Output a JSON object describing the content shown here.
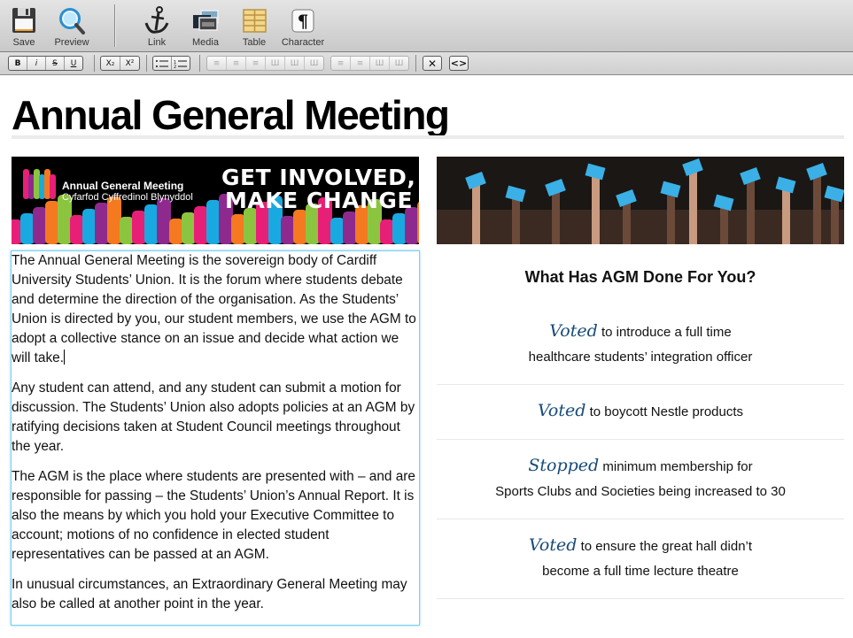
{
  "toolbar": {
    "buttons": [
      {
        "label": "Save",
        "icon": "floppy-disk-icon"
      },
      {
        "label": "Preview",
        "icon": "magnifier-icon"
      },
      {
        "label": "Link",
        "icon": "anchor-icon"
      },
      {
        "label": "Media",
        "icon": "media-icon"
      },
      {
        "label": "Table",
        "icon": "table-icon"
      },
      {
        "label": "Character",
        "icon": "pilcrow-icon"
      }
    ]
  },
  "format_toolbar": {
    "text_style": [
      "B",
      "i",
      "S",
      "U"
    ],
    "script": [
      "X₂",
      "X²"
    ],
    "lists": [
      "bulleted-list",
      "numbered-list"
    ],
    "table_row_col": [
      "insert-row-before",
      "insert-row-after",
      "delete-row",
      "insert-col-before",
      "insert-col-after",
      "delete-col"
    ],
    "table_cells": [
      "split-cell",
      "merge-cell",
      "split-col",
      "merge-col"
    ],
    "remove_format": "✕",
    "source_code": "<>"
  },
  "page": {
    "title": "Annual General Meeting",
    "banner_left": {
      "title": "Annual General Meeting",
      "subtitle": "Cyfarfod Cyffredinol Blynyddol",
      "headline_1": "GET INVOLVED,",
      "headline_2": "MAKE CHANGE"
    },
    "paragraphs": [
      "The Annual General Meeting is the sovereign body of Cardiff University Students’ Union. It is the forum where students debate and determine the direction of the organisation. As the Students’ Union is directed by you, our student members, we use the AGM to adopt a collective stance on an issue and decide what action we will take.",
      "Any student can attend, and any student can submit a motion for discussion. The Students’ Union also adopts policies at an AGM by ratifying decisions taken at Student Council meetings throughout the year.",
      "The AGM is the place where students are presented with – and are responsible for passing – the Students’ Union’s Annual Report. It is also the means by which you hold your Executive Committee to account; motions of no confidence in elected student representatives can be passed at an AGM.",
      "In unusual circumstances, an Extraordinary General Meeting may also be called at another point in the year."
    ],
    "sidebar": {
      "heading": "What Has AGM Done For You?",
      "items": [
        {
          "verb": "Voted",
          "line1": "to introduce a full time",
          "line2": "healthcare students’ integration officer"
        },
        {
          "verb": "Voted",
          "line1": "to boycott Nestle products",
          "line2": ""
        },
        {
          "verb": "Stopped",
          "line1": "minimum membership for",
          "line2": "Sports Clubs and Societies being increased to 30"
        },
        {
          "verb": "Voted",
          "line1": "to ensure the great hall didn’t",
          "line2": "become a full time lecture theatre"
        }
      ],
      "accent_color": "#174a78"
    }
  }
}
